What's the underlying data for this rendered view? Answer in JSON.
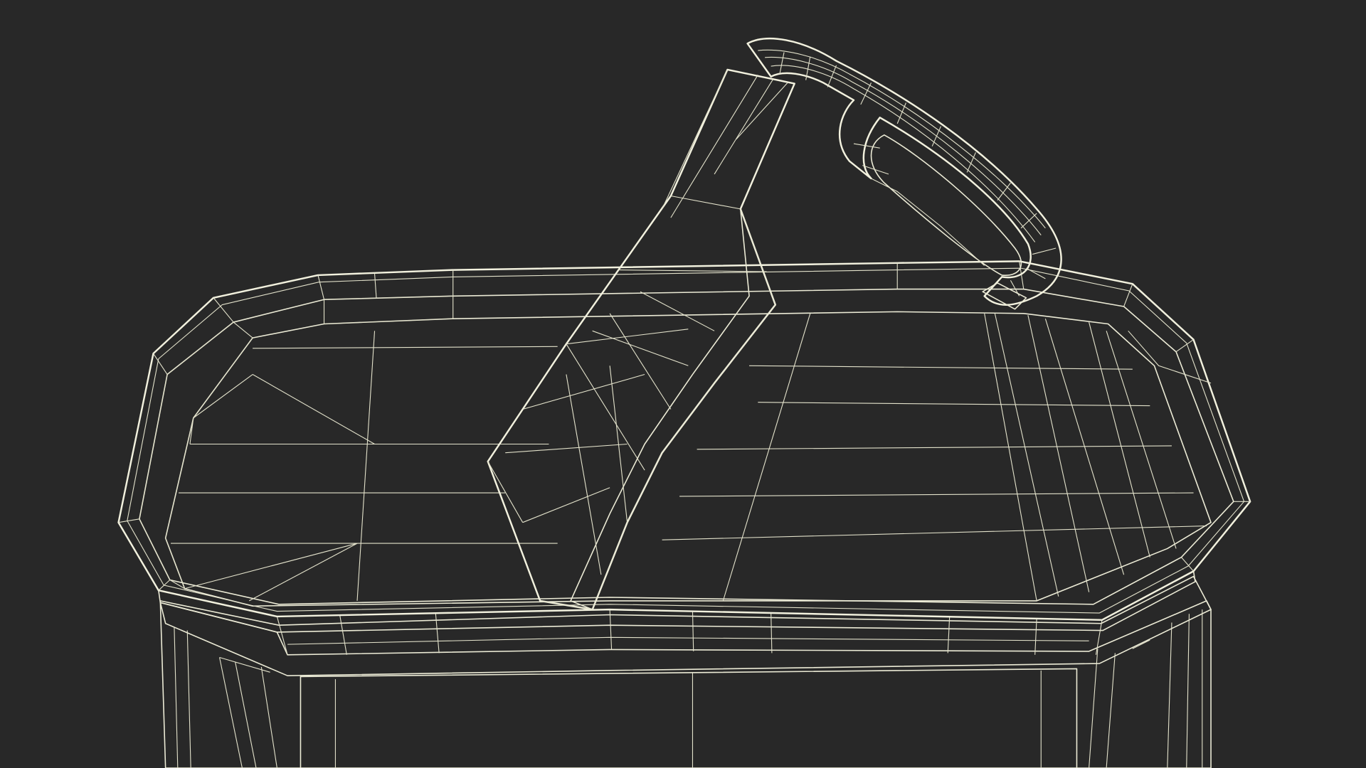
{
  "scene": {
    "subject": "",
    "colors": {
      "background": "#282828",
      "surface": "#6d6e5e",
      "surface_light": "#7c7d6c",
      "surface_dark": "#5f6052",
      "wire": "#ecebd6"
    }
  }
}
